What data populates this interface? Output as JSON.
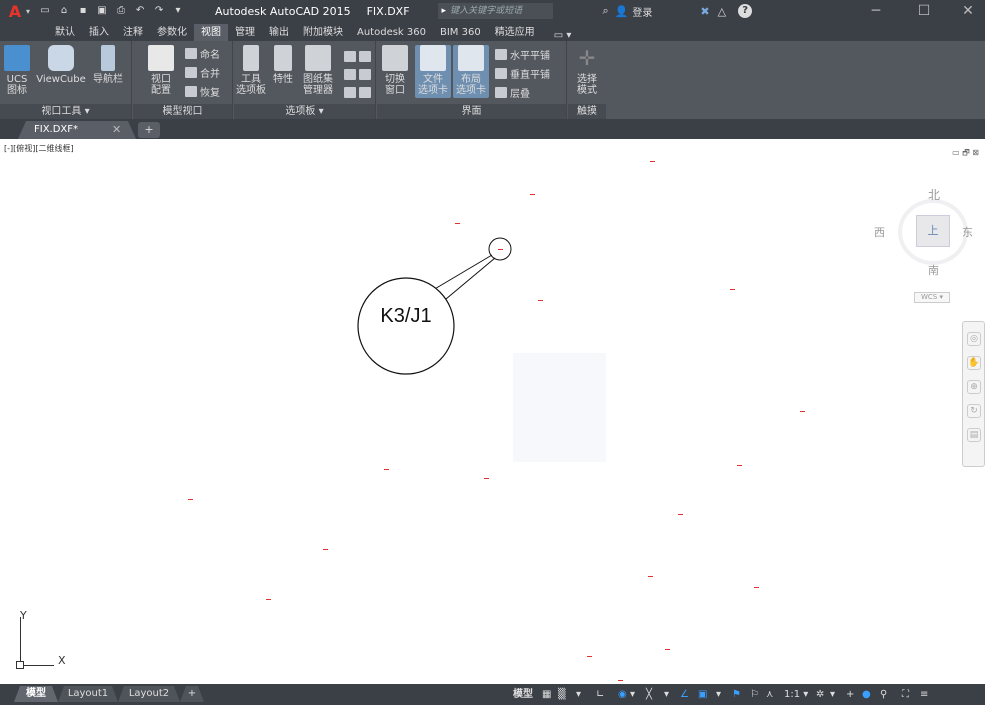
{
  "titlebar": {
    "app_title": "Autodesk AutoCAD 2015",
    "file_title": "FIX.DXF",
    "search_placeholder": "键入关键字或短语",
    "login": "登录",
    "minimize": "─",
    "maximize": "☐",
    "close": "✕"
  },
  "ribbon_tabs": [
    "默认",
    "插入",
    "注释",
    "参数化",
    "视图",
    "管理",
    "输出",
    "附加模块",
    "Autodesk 360",
    "BIM 360",
    "精选应用"
  ],
  "active_tab": "视图",
  "ribbon": {
    "viewport_tools": {
      "title": "视口工具 ▾",
      "ucs": "UCS\n图标",
      "viewcube": "ViewCube",
      "navbar": "导航栏"
    },
    "model_viewports": {
      "title": "模型视口",
      "viewport_config": "视口\n配置",
      "named": "命名",
      "join": "合并",
      "restore": "恢复"
    },
    "palettes": {
      "title": "选项板 ▾",
      "tool_palettes": "工具\n选项板",
      "properties": "特性",
      "sheet_set": "图纸集\n管理器"
    },
    "interface": {
      "title": "界面",
      "switch_windows": "切换\n窗口",
      "file_tabs": "文件\n选项卡",
      "layout_tabs": "布局\n选项卡",
      "tile_horizontal": "水平平铺",
      "tile_vertical": "垂直平铺",
      "cascade": "层叠"
    },
    "touch": {
      "title": "触摸",
      "select_mode": "选择\n模式"
    }
  },
  "doc_tab": {
    "file": "FIX.DXF*",
    "close": "✕",
    "new": "+"
  },
  "viewport": {
    "label": "[-][俯视][二维线框]",
    "controls": "▭ 🗗 ⊠"
  },
  "viewcube": {
    "north": "北",
    "south": "南",
    "east": "东",
    "west": "西",
    "face": "上",
    "wcs": "WCS ▾"
  },
  "ucs": {
    "x": "X",
    "y": "Y"
  },
  "callout": {
    "label": "K3/J1"
  },
  "statusbar": {
    "model_tab": "模型",
    "layouts": [
      "Layout1",
      "Layout2"
    ],
    "add_layout": "+",
    "model_btn": "模型",
    "scale": "1:1 ▾"
  }
}
